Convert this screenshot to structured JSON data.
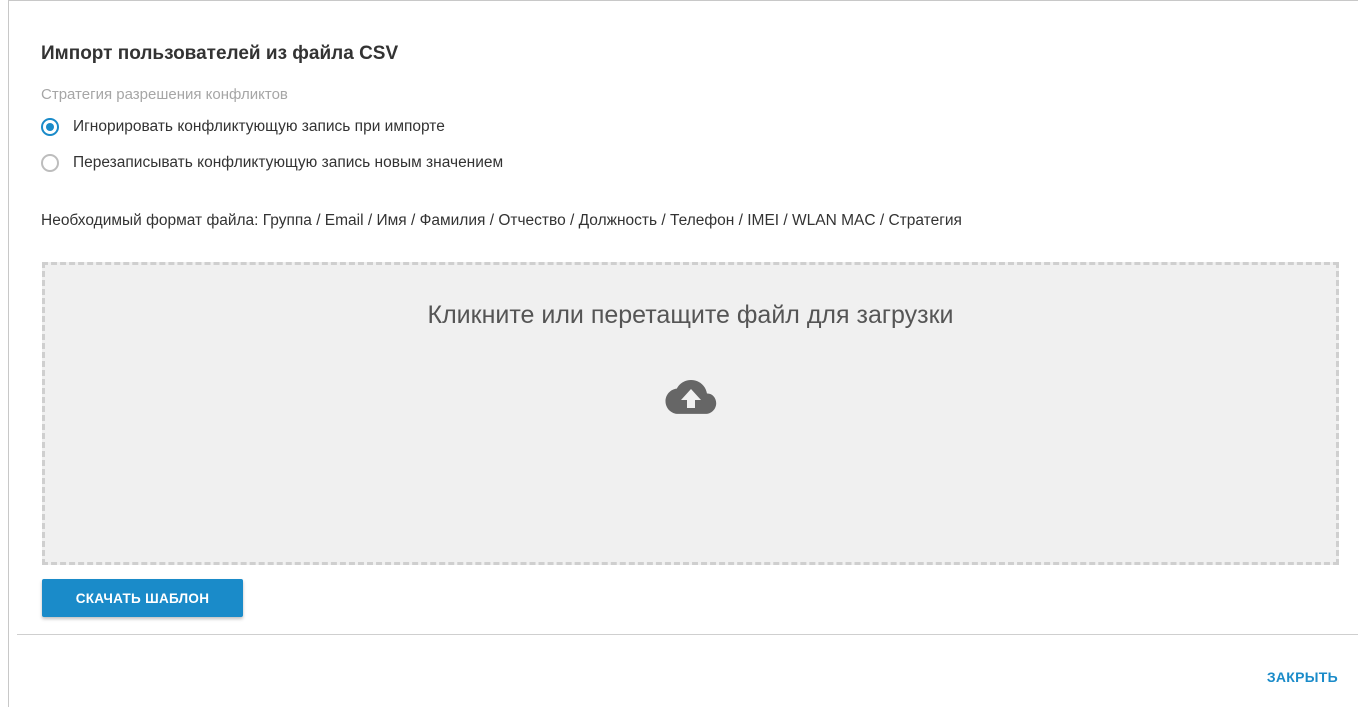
{
  "dialog": {
    "title": "Импорт пользователей из файла CSV",
    "strategy_label": "Стратегия разрешения конфликтов",
    "options": [
      {
        "label": "Игнорировать конфликтующую запись при импорте",
        "checked": true
      },
      {
        "label": "Перезаписывать конфликтующую запись новым значением",
        "checked": false
      }
    ],
    "format_text": "Необходимый формат файла: Группа / Email / Имя / Фамилия / Отчество / Должность / Телефон / IMEI / WLAN MAC / Стратегия",
    "dropzone": {
      "text": "Кликните или перетащите файл для загрузки",
      "icon": "cloud-upload-icon"
    },
    "download_button": "СКАЧАТЬ ШАБЛОН",
    "close_button": "ЗАКРЫТЬ"
  },
  "colors": {
    "accent": "#1a8bc9",
    "dropzone_bg": "#f0f0f0",
    "muted_text": "#a6a6a6"
  }
}
